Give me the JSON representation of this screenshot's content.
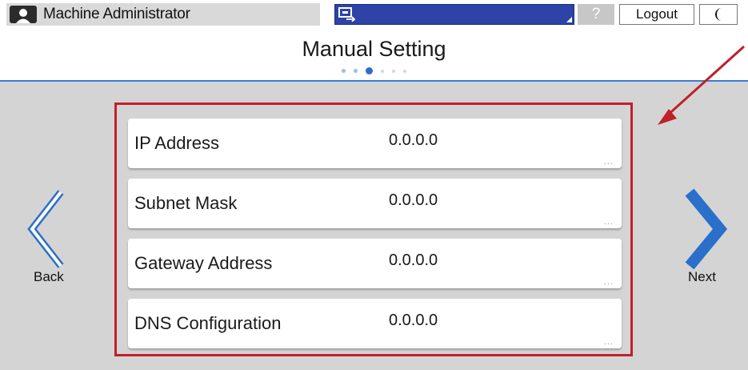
{
  "topbar": {
    "user_name": "Machine Administrator",
    "help_label": "?",
    "logout_label": "Logout"
  },
  "header": {
    "title": "Manual Setting",
    "pager_total": 6,
    "pager_current": 3
  },
  "rows": [
    {
      "label": "IP Address",
      "value": "0.0.0.0",
      "more": "..."
    },
    {
      "label": "Subnet Mask",
      "value": "0.0.0.0",
      "more": "..."
    },
    {
      "label": "Gateway Address",
      "value": "0.0.0.0",
      "more": "..."
    },
    {
      "label": "DNS Configuration",
      "value": "0.0.0.0",
      "more": "..."
    }
  ],
  "nav": {
    "back_label": "Back",
    "next_label": "Next"
  },
  "colors": {
    "accent_blue": "#2a6fc9",
    "highlight_red": "#c0202a",
    "status_blue": "#2e43a7"
  }
}
